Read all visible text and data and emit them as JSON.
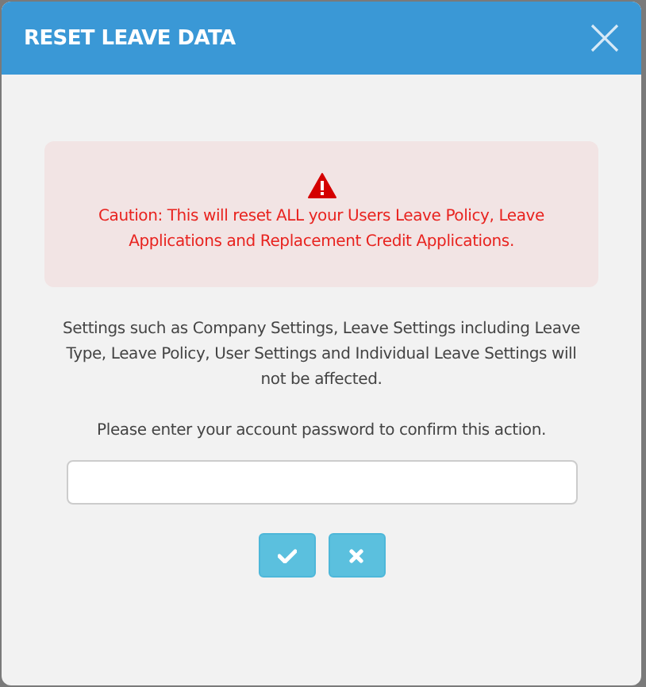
{
  "dialog": {
    "title": "RESET LEAVE DATA"
  },
  "caution": {
    "text": "Caution: This will reset ALL your Users Leave Policy, Leave Applications and Replacement Credit Applications."
  },
  "info": "Settings such as Company Settings, Leave Settings including Leave Type, Leave Policy, User Settings and Individual Leave Settings will not be affected.",
  "prompt": "Please enter your account password to confirm this action.",
  "buttons": [
    {
      "kind": "confirm"
    },
    {
      "kind": "cancel"
    }
  ]
}
